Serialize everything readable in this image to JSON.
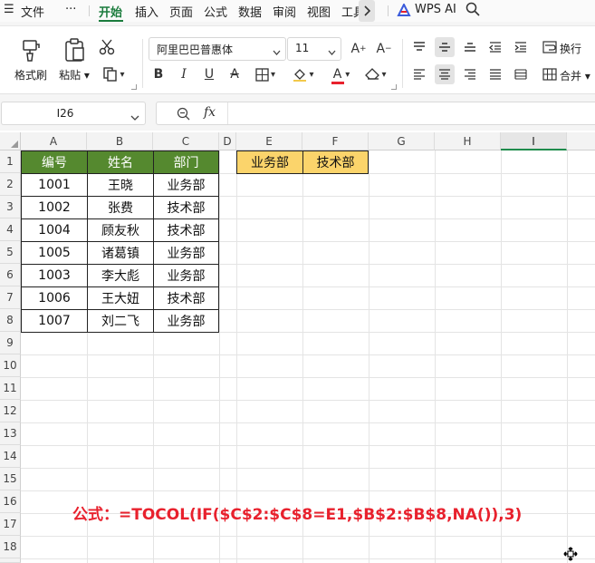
{
  "menu": {
    "file": "文件",
    "more": "···",
    "tabs": [
      "开始",
      "插入",
      "页面",
      "公式",
      "数据",
      "审阅",
      "视图",
      "工具"
    ],
    "active_tab": "开始",
    "ai": "WPS AI"
  },
  "ribbon": {
    "format_painter": "格式刷",
    "paste": "粘贴",
    "font_name": "阿里巴巴普惠体",
    "font_size": "11",
    "wrap": "换行",
    "merge": "合并",
    "font_color": "#e8212d",
    "fill_color": "#f2c94c"
  },
  "formula_bar": {
    "cell_ref": "I26",
    "fx": "fx",
    "content": ""
  },
  "sheet": {
    "columns": [
      "A",
      "B",
      "C",
      "D",
      "E",
      "F",
      "G",
      "H",
      "I"
    ],
    "selected_column": "I",
    "rows": [
      "1",
      "2",
      "3",
      "4",
      "5",
      "6",
      "7",
      "8",
      "9",
      "10",
      "11",
      "12",
      "13",
      "14",
      "15",
      "16",
      "17",
      "18"
    ],
    "table_headers": [
      "编号",
      "姓名",
      "部门"
    ],
    "table_rows": [
      [
        "1001",
        "王晓",
        "业务部"
      ],
      [
        "1002",
        "张费",
        "技术部"
      ],
      [
        "1004",
        "顾友秋",
        "技术部"
      ],
      [
        "1005",
        "诸葛镇",
        "业务部"
      ],
      [
        "1003",
        "李大彪",
        "业务部"
      ],
      [
        "1006",
        "王大妞",
        "技术部"
      ],
      [
        "1007",
        "刘二飞",
        "业务部"
      ]
    ],
    "criteria": [
      "业务部",
      "技术部"
    ],
    "header_color": "#55892f",
    "criteria_color": "#fbd46b"
  },
  "annotation": {
    "formula_text": "公式：=TOCOL(IF($C$2:$C$8=E1,$B$2:$B$8,NA()),3)",
    "color": "#e8212d"
  }
}
